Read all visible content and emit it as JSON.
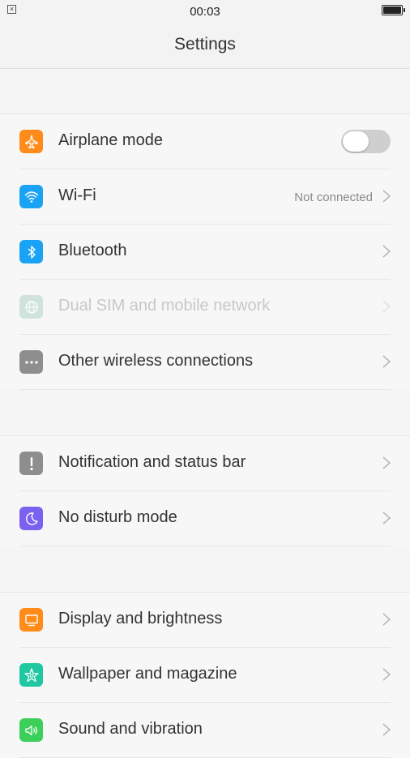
{
  "status_bar": {
    "time": "00:03"
  },
  "header": {
    "title": "Settings"
  },
  "groups": [
    {
      "items": [
        {
          "label": "Airplane mode",
          "icon": "airplane-icon",
          "color": "#ff8c1a",
          "toggle": "off"
        },
        {
          "label": "Wi-Fi",
          "icon": "wifi-icon",
          "color": "#1aa3f5",
          "status": "Not connected"
        },
        {
          "label": "Bluetooth",
          "icon": "bluetooth-icon",
          "color": "#1aa3f5"
        },
        {
          "label": "Dual SIM and mobile network",
          "icon": "globe-icon",
          "color": "#cfe3dc",
          "disabled": true
        },
        {
          "label": "Other wireless connections",
          "icon": "more-icon",
          "color": "#8e8e8e"
        }
      ]
    },
    {
      "items": [
        {
          "label": "Notification and status bar",
          "icon": "exclamation-icon",
          "color": "#8e8e8e"
        },
        {
          "label": "No disturb mode",
          "icon": "moon-icon",
          "color": "#7b61f0"
        }
      ]
    },
    {
      "items": [
        {
          "label": "Display and brightness",
          "icon": "monitor-icon",
          "color": "#ff8c1a"
        },
        {
          "label": "Wallpaper and magazine",
          "icon": "flower-icon",
          "color": "#1fc8a0"
        },
        {
          "label": "Sound and vibration",
          "icon": "speaker-icon",
          "color": "#3ccf5a"
        }
      ]
    }
  ]
}
